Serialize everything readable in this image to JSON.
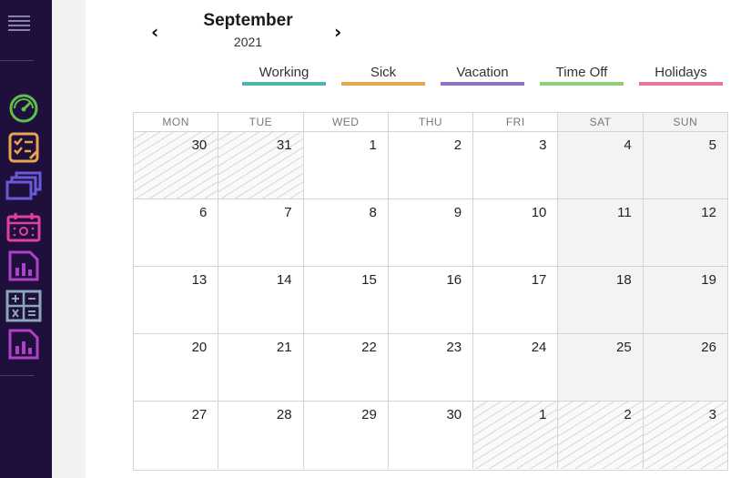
{
  "sidebar": {
    "icons": [
      "speedometer-icon",
      "checklist-icon",
      "stacked-windows-icon",
      "calendar-icon",
      "report-chart-icon",
      "calculator-icon",
      "report-chart-icon"
    ]
  },
  "header": {
    "month": "September",
    "year": "2021",
    "prev_icon": "chevron-left-icon",
    "next_icon": "chevron-right-icon"
  },
  "legend": [
    {
      "label": "Working",
      "color": "#4db6ac"
    },
    {
      "label": "Sick",
      "color": "#e8a64c"
    },
    {
      "label": "Vacation",
      "color": "#8e72c8"
    },
    {
      "label": "Time Off",
      "color": "#8fcf7a"
    },
    {
      "label": "Holidays",
      "color": "#e8749a"
    }
  ],
  "calendar": {
    "weekdays": [
      "MON",
      "TUE",
      "WED",
      "THU",
      "FRI",
      "SAT",
      "SUN"
    ],
    "weeks": [
      [
        {
          "d": "30",
          "other": true
        },
        {
          "d": "31",
          "other": true
        },
        {
          "d": "1"
        },
        {
          "d": "2"
        },
        {
          "d": "3"
        },
        {
          "d": "4"
        },
        {
          "d": "5"
        }
      ],
      [
        {
          "d": "6"
        },
        {
          "d": "7"
        },
        {
          "d": "8"
        },
        {
          "d": "9"
        },
        {
          "d": "10"
        },
        {
          "d": "11"
        },
        {
          "d": "12"
        }
      ],
      [
        {
          "d": "13"
        },
        {
          "d": "14"
        },
        {
          "d": "15"
        },
        {
          "d": "16"
        },
        {
          "d": "17"
        },
        {
          "d": "18"
        },
        {
          "d": "19"
        }
      ],
      [
        {
          "d": "20"
        },
        {
          "d": "21"
        },
        {
          "d": "22"
        },
        {
          "d": "23"
        },
        {
          "d": "24"
        },
        {
          "d": "25"
        },
        {
          "d": "26"
        }
      ],
      [
        {
          "d": "27"
        },
        {
          "d": "28"
        },
        {
          "d": "29"
        },
        {
          "d": "30"
        },
        {
          "d": "1",
          "other": true
        },
        {
          "d": "2",
          "other": true
        },
        {
          "d": "3",
          "other": true
        }
      ]
    ]
  }
}
